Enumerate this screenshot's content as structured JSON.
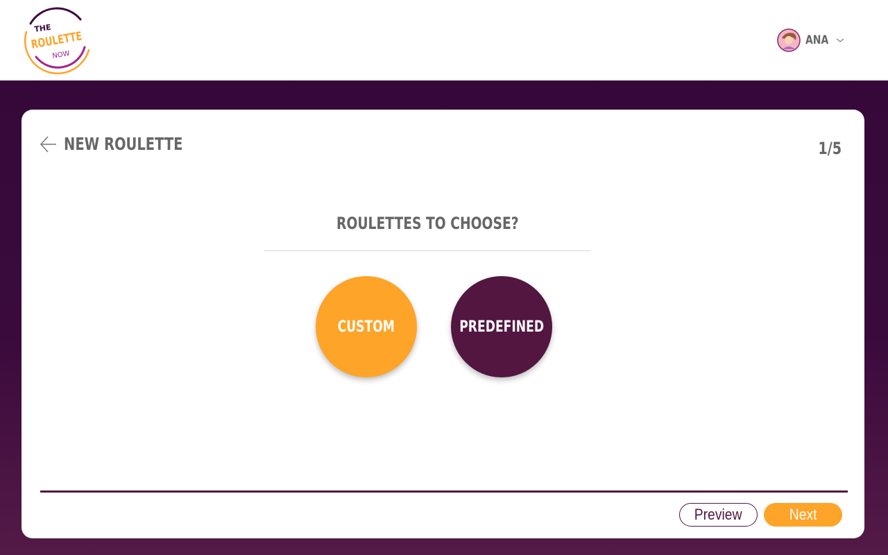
{
  "brand": {
    "logo_line1": "THE",
    "logo_line2": "ROULETTE",
    "logo_line3": "NOW",
    "colors": {
      "purple": "#521641",
      "orange": "#fea429",
      "background": "#340839"
    }
  },
  "user": {
    "name": "ANA",
    "avatar_icon": "avatar-icon",
    "menu_icon": "chevron-down-icon"
  },
  "wizard": {
    "title": "NEW ROULETTE",
    "back_icon": "arrow-left-icon",
    "step": "1/5",
    "question": "ROULETTES TO CHOOSE?",
    "choices": [
      {
        "label": "CUSTOM",
        "color": "#fea429"
      },
      {
        "label": "PREDEFINED",
        "color": "#521641"
      }
    ],
    "preview_label": "Preview",
    "next_label": "Next"
  }
}
